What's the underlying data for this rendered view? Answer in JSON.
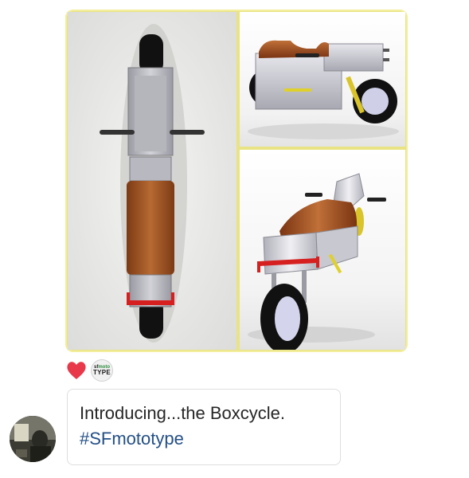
{
  "post": {
    "media": {
      "panels": [
        {
          "view": "top"
        },
        {
          "view": "side"
        },
        {
          "view": "front-three-quarter"
        }
      ],
      "frame_color": "#e9e384"
    },
    "reactions": {
      "like_icon": "heart-icon",
      "like_color": "#e8394a",
      "reactor_avatar": {
        "line1_prefix": "sf",
        "line1_accent": "moto",
        "line2": "TYPE"
      }
    },
    "comment": {
      "text": "Introducing...the Boxcycle.",
      "hashtag": "#SFmototype",
      "hashtag_color": "#234f86"
    },
    "author_avatar": "user-avatar"
  }
}
